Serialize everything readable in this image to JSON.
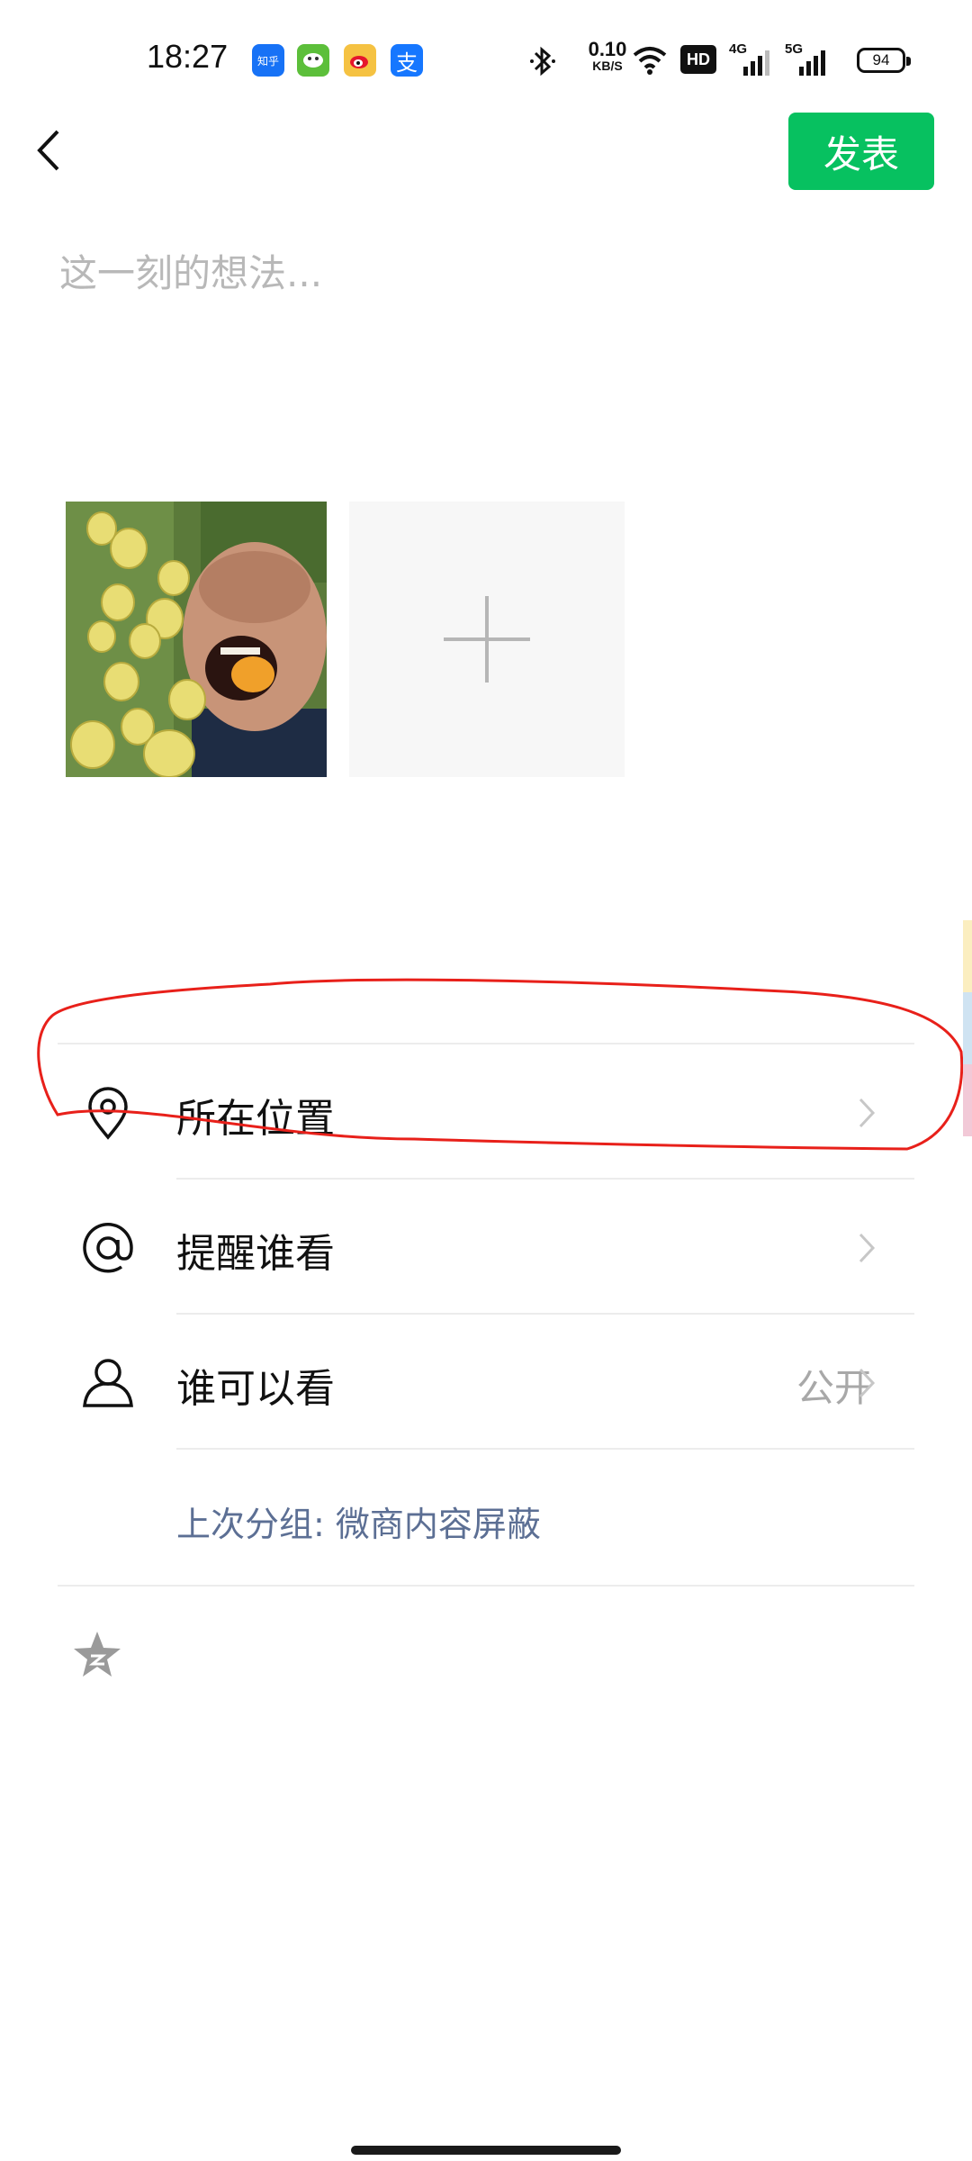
{
  "status_bar": {
    "time": "18:27",
    "app_icons": [
      {
        "name": "zhihu-icon",
        "text": "知乎",
        "color": "#1772f6"
      },
      {
        "name": "app-green-icon",
        "text": "",
        "color": "#5cbf3a"
      },
      {
        "name": "weibo-icon",
        "text": "",
        "color": "#f5c242"
      },
      {
        "name": "alipay-icon",
        "text": "支",
        "color": "#1677ff"
      }
    ],
    "net_speed_value": "0.10",
    "net_speed_unit": "KB/S",
    "hd_label": "HD",
    "signal_4g": "4G",
    "signal_5g": "5G",
    "battery": "94"
  },
  "header": {
    "publish_label": "发表"
  },
  "compose": {
    "placeholder": "这一刻的想法..."
  },
  "menu": {
    "location_label": "所在位置",
    "remind_label": "提醒谁看",
    "visibility_label": "谁可以看",
    "visibility_value": "公开",
    "last_group_text": "上次分组: 微商内容屏蔽"
  },
  "colors": {
    "accent": "#07c160",
    "annotation": "#e8201a",
    "link_text": "#5c6f94"
  }
}
